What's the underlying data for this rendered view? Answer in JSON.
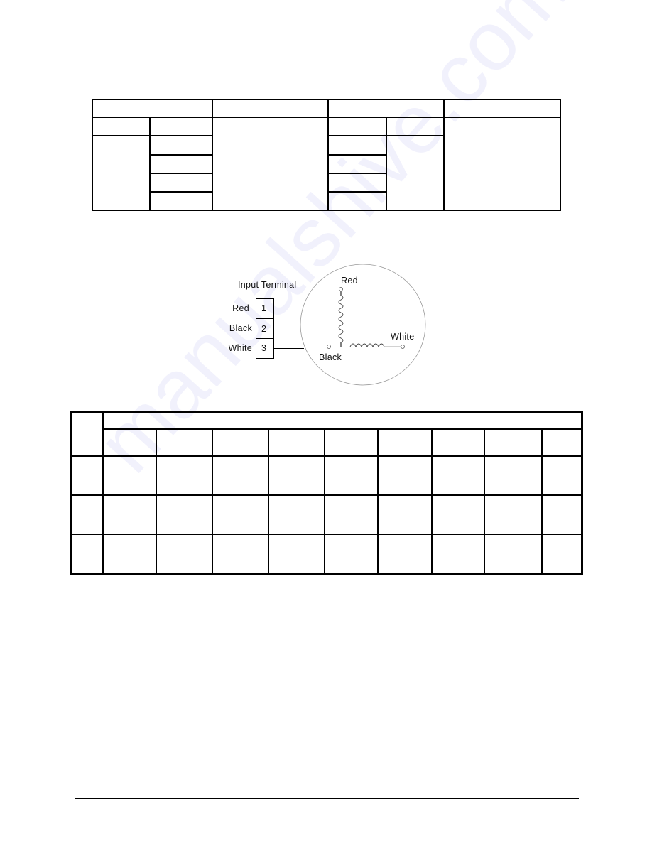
{
  "watermark": "manualshive.com",
  "wiring_diagram": {
    "title": "Input Terminal",
    "terminals": [
      {
        "number": "1",
        "wire": "Red"
      },
      {
        "number": "2",
        "wire": "Black"
      },
      {
        "number": "3",
        "wire": "White"
      }
    ],
    "motor_leads": {
      "top": "Red",
      "bottom_left": "Black",
      "right": "White"
    }
  },
  "table_top": {
    "rows": [
      [
        "",
        "",
        "",
        "",
        "",
        ""
      ],
      [
        "",
        "",
        "",
        "",
        "",
        ""
      ],
      [
        "",
        "",
        "",
        "",
        "",
        ""
      ],
      [
        "",
        "",
        "",
        "",
        "",
        ""
      ],
      [
        "",
        "",
        "",
        "",
        "",
        ""
      ],
      [
        "",
        "",
        "",
        "",
        "",
        ""
      ]
    ]
  },
  "table_bottom": {
    "rows": [
      [
        "",
        "",
        "",
        "",
        "",
        "",
        "",
        "",
        "",
        ""
      ],
      [
        "",
        "",
        "",
        "",
        "",
        "",
        "",
        "",
        "",
        ""
      ],
      [
        "",
        "",
        "",
        "",
        "",
        "",
        "",
        "",
        "",
        ""
      ],
      [
        "",
        "",
        "",
        "",
        "",
        "",
        "",
        "",
        "",
        ""
      ]
    ]
  }
}
